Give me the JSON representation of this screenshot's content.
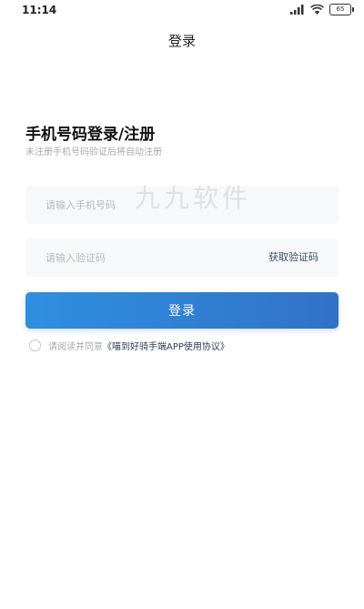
{
  "status_bar": {
    "time": "11:14",
    "battery": "65"
  },
  "header": {
    "title": "登录"
  },
  "login_form": {
    "heading": "手机号码登录/注册",
    "subheading": "未注册手机号码验证后将自动注册",
    "phone_placeholder": "请输入手机号码",
    "code_placeholder": "请输入验证码",
    "get_code_label": "获取验证码",
    "submit_label": "登录"
  },
  "agreement": {
    "prefix": "请阅读并同意",
    "link": "《喵到好骑手端APP使用协议》"
  },
  "watermark": "九九软件",
  "colors": {
    "accent_start": "#2f8fe0",
    "accent_end": "#3172c9",
    "link": "#2d3e55"
  }
}
